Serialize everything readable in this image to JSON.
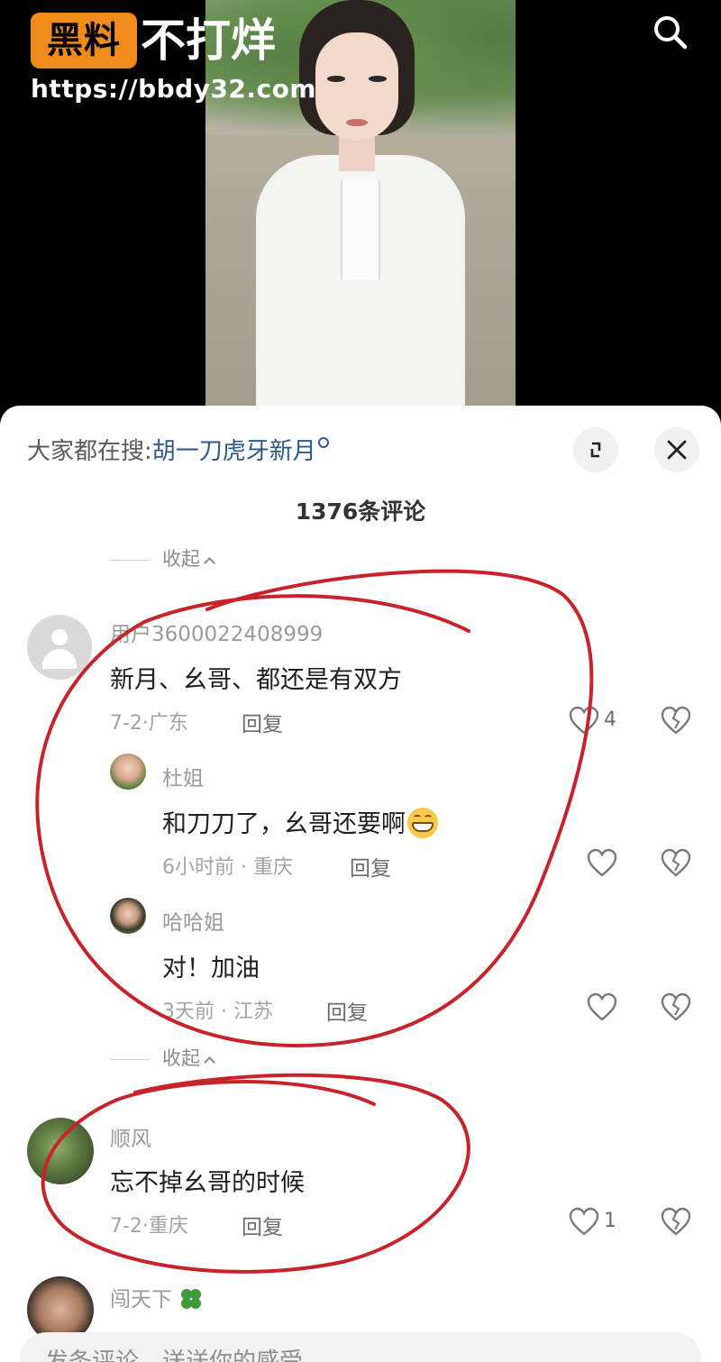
{
  "watermark": {
    "badge": "黑料",
    "text": "不打烊",
    "url": "https://bbdy32.com"
  },
  "hot_search": {
    "prefix": "大家都在搜:",
    "term": "胡一刀虎牙新月"
  },
  "comment_count": "1376条评论",
  "collapse_label": "收起",
  "comments": [
    {
      "user": "用户3600022408999",
      "text": "新月、幺哥、都还是有双方",
      "meta": "7-2·广东",
      "reply_label": "回复",
      "likes": "4"
    },
    {
      "user": "杜姐",
      "text": "和刀刀了，幺哥还要啊",
      "meta": "6小时前 · 重庆",
      "reply_label": "回复",
      "likes": ""
    },
    {
      "user": "哈哈姐",
      "text": "对！加油",
      "meta": "3天前 · 江苏",
      "reply_label": "回复",
      "likes": ""
    },
    {
      "user": "顺风",
      "text": "忘不掉幺哥的时候",
      "meta": "7-2·重庆",
      "reply_label": "回复",
      "likes": "1"
    },
    {
      "user": "闯天下"
    }
  ],
  "input_placeholder": "发条评论，送送你的感受",
  "colors": {
    "accent_link": "#2d5a8e",
    "watermark_badge": "#f08a1a",
    "annotation": "#c8232b"
  },
  "icons": [
    "search-icon",
    "expand-icon",
    "close-icon",
    "heart-icon",
    "broken-heart-icon",
    "grin-emoji",
    "clover-emoji"
  ]
}
